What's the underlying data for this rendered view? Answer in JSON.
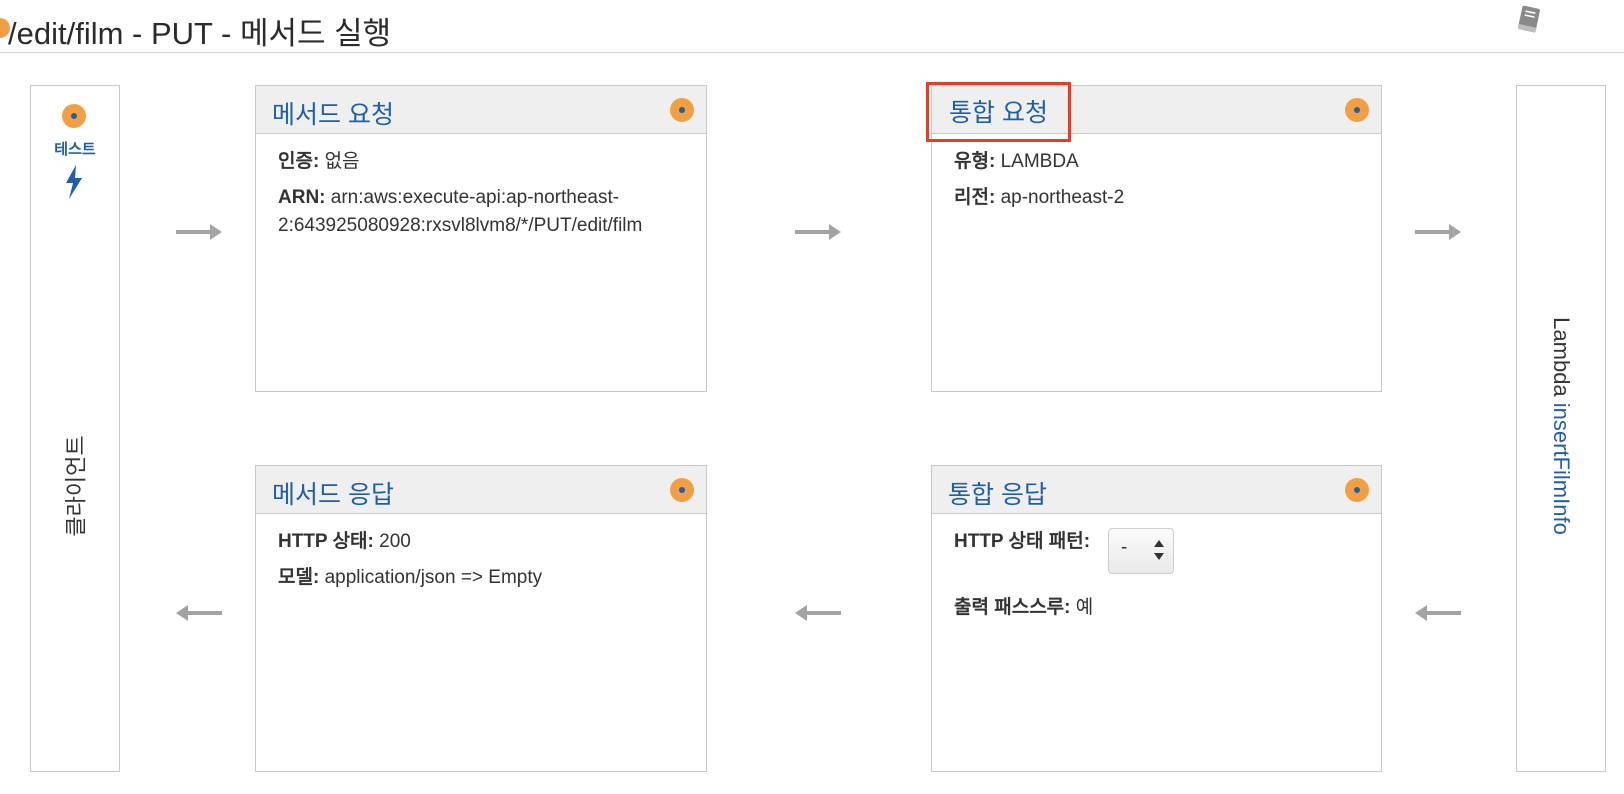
{
  "header": {
    "title": "/edit/film - PUT - 메서드 실행",
    "book_icon": "book-icon"
  },
  "client": {
    "test_label": "테스트",
    "label": "클라이언트"
  },
  "lambda": {
    "prefix": "Lambda",
    "function_name": "insertFilmInfo"
  },
  "method_request": {
    "title": "메서드 요청",
    "auth_label": "인증:",
    "auth_value": "없음",
    "arn_label": "ARN:",
    "arn_line1": "arn:aws:execute-api:ap-northeast-",
    "arn_line2": "2:643925080928:rxsvl8lvm8/*/PUT/edit/film"
  },
  "integration_request": {
    "title": "통합 요청",
    "type_label": "유형:",
    "type_value": "LAMBDA",
    "region_label": "리전:",
    "region_value": "ap-northeast-2"
  },
  "method_response": {
    "title": "메서드 응답",
    "status_label": "HTTP 상태:",
    "status_value": "200",
    "model_label": "모델:",
    "model_value": "application/json => Empty"
  },
  "integration_response": {
    "title": "통합 응답",
    "pattern_label": "HTTP 상태 패턴:",
    "pattern_selected": "-",
    "passthrough_label": "출력 패스스루:",
    "passthrough_value": "예"
  },
  "colors": {
    "accent_orange": "#f0a043",
    "link_blue": "#1f5fa8",
    "highlight_red": "#e0402b"
  }
}
